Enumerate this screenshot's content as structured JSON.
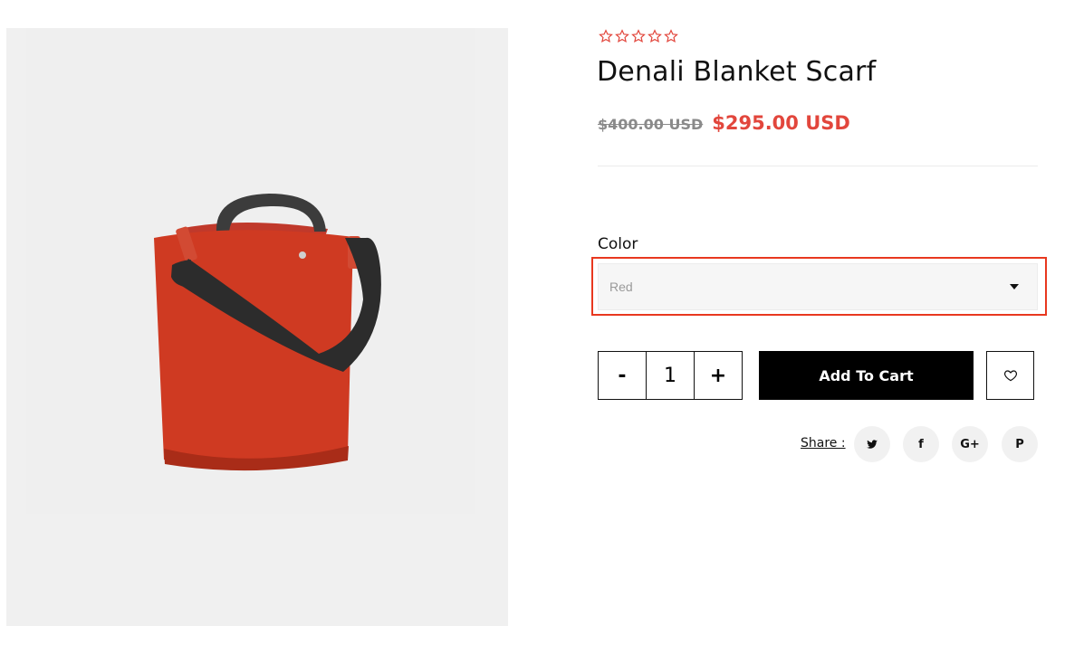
{
  "product": {
    "title": "Denali Blanket Scarf",
    "price_old": "$400.00 USD",
    "price_new": "$295.00 USD",
    "rating_stars": 5
  },
  "options": {
    "color_label": "Color",
    "color_selected": "Red"
  },
  "quantity": {
    "minus": "-",
    "value": "1",
    "plus": "+"
  },
  "actions": {
    "add_to_cart": "Add To Cart",
    "wishlist_icon": "heart-icon"
  },
  "share": {
    "label": "Share :",
    "networks": [
      {
        "name": "twitter",
        "glyph": ""
      },
      {
        "name": "facebook",
        "glyph": "f"
      },
      {
        "name": "google-plus",
        "glyph": "G+"
      },
      {
        "name": "pinterest",
        "glyph": "P"
      }
    ]
  },
  "colors": {
    "sale": "#e2463c",
    "highlight": "#e8381f",
    "star": "#e2463c"
  }
}
